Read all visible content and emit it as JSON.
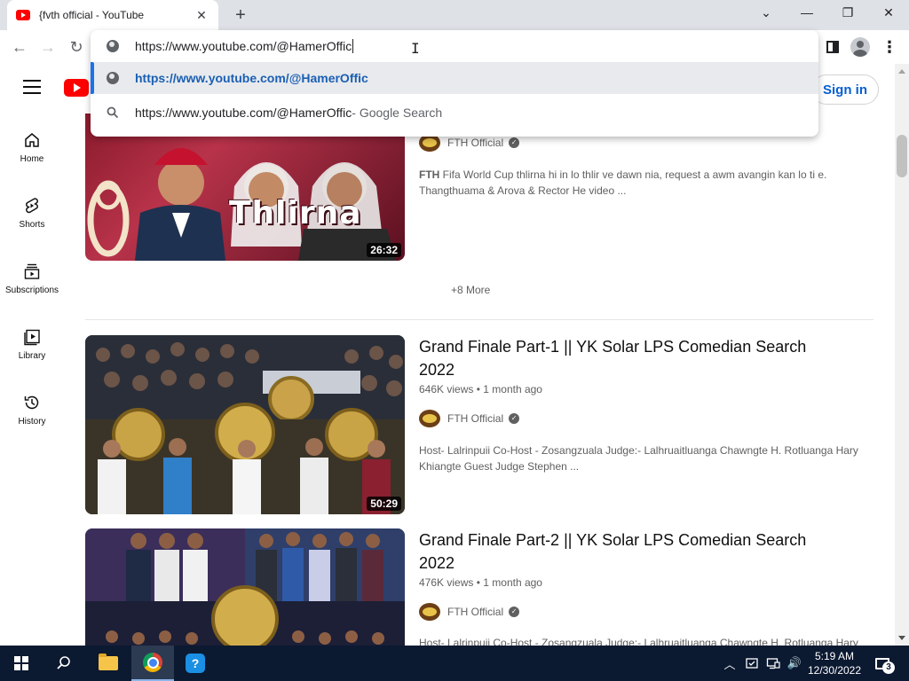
{
  "browser": {
    "tab_title": "{fvth official - YouTube",
    "tab_close": "✕",
    "new_tab": "+",
    "window_controls": {
      "list": "⌄",
      "minimize": "—",
      "restore": "❐",
      "close": "✕"
    },
    "nav": {
      "back": "←",
      "forward": "→",
      "reload": "↻"
    },
    "menu": "⋮"
  },
  "omnibox": {
    "value": "https://www.youtube.com/@HamerOffic",
    "suggestions": [
      {
        "text": "https://www.youtube.com/@HamerOffic",
        "icon": "globe-icon"
      },
      {
        "text": "https://www.youtube.com/@HamerOffic",
        "suffix": " - Google Search",
        "icon": "search-icon"
      }
    ]
  },
  "youtube": {
    "signin_label": "Sign in",
    "nav_items": [
      {
        "label": "Home",
        "icon": "home-icon"
      },
      {
        "label": "Shorts",
        "icon": "shorts-icon"
      },
      {
        "label": "Subscriptions",
        "icon": "subscriptions-icon"
      },
      {
        "label": "Library",
        "icon": "library-icon"
      },
      {
        "label": "History",
        "icon": "history-icon"
      }
    ],
    "more_label": "+8 More",
    "videos": [
      {
        "thumb_text": "Thlirna",
        "duration": "26:32",
        "channel": "FTH Official",
        "desc_bold": "FTH",
        "description": " Fifa World Cup thlirna hi in lo thlir ve dawn nia, request a awm avangin kan lo ti e. Thangthuama & Arova & Rector He video ..."
      },
      {
        "title": "Grand Finale Part-1 || YK Solar LPS Comedian Search 2022",
        "views": "646K views",
        "age": "1 month ago",
        "duration": "50:29",
        "channel": "FTH Official",
        "description": "Host- Lalrinpuii Co-Host - Zosangzuala Judge:- Lalhruaitluanga Chawngte H. Rotluanga Hary Khiangte Guest Judge Stephen ..."
      },
      {
        "title": "Grand Finale Part-2 || YK Solar LPS Comedian Search 2022",
        "views": "476K views",
        "age": "1 month ago",
        "channel": "FTH Official",
        "description": "Host- Lalrinpuii Co-Host - Zosangzuala Judge:- Lalhruaitluanga Chawngte H. Rotluanga Hary"
      }
    ],
    "meta_separator": "•",
    "verified": "✓"
  },
  "taskbar": {
    "help_glyph": "?",
    "tray_chevron": "︿",
    "tray_volume": "🔊",
    "time": "5:19 AM",
    "date": "12/30/2022",
    "notification_count": "3"
  },
  "colors": {
    "youtube_red": "#ff0000",
    "link_blue": "#065fd4",
    "taskbar_bg": "#0b1931",
    "suggestion_highlight": "#e8eaed"
  }
}
